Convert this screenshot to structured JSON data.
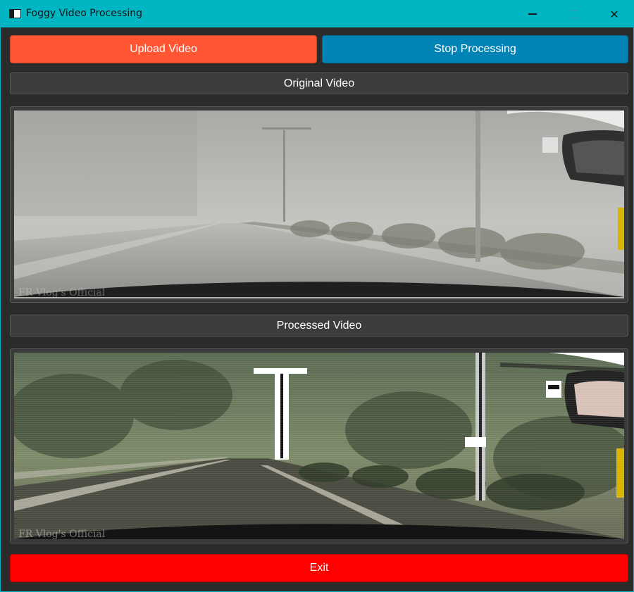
{
  "window": {
    "title": "Foggy Video Processing",
    "controls": {
      "minimize": "—",
      "maximize": "□",
      "close": "✕"
    }
  },
  "toolbar": {
    "upload_label": "Upload Video",
    "stop_label": "Stop Processing"
  },
  "sections": {
    "original_label": "Original Video",
    "processed_label": "Processed Video"
  },
  "footer": {
    "exit_label": "Exit"
  },
  "colors": {
    "titlebar": "#00b6c3",
    "upload": "#ff5533",
    "stop": "#0183b6",
    "exit": "#fe0000",
    "background": "#2b2b2b"
  },
  "icons": {
    "app": "window-icon",
    "minimize": "minimize-icon",
    "maximize": "maximize-icon",
    "close": "close-icon"
  },
  "videos": {
    "original_watermark": "FR Vlog's Official",
    "processed_watermark": "FR Vlog's Official"
  }
}
